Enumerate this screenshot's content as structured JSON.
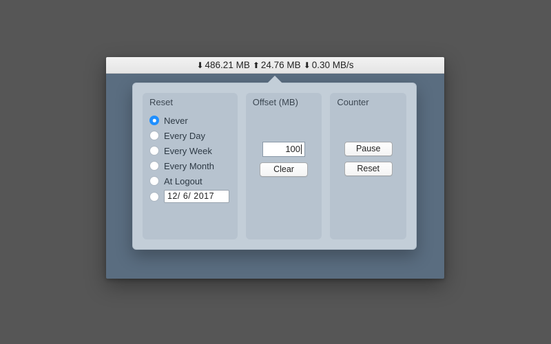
{
  "titlebar": {
    "download_total": "486.21 MB",
    "upload_total": "24.76 MB",
    "rate": "0.30 MB/s"
  },
  "popover": {
    "reset": {
      "title": "Reset",
      "options": [
        {
          "label": "Never",
          "selected": true
        },
        {
          "label": "Every Day",
          "selected": false
        },
        {
          "label": "Every Week",
          "selected": false
        },
        {
          "label": "Every Month",
          "selected": false
        },
        {
          "label": "At Logout",
          "selected": false
        }
      ],
      "date_field": "12/ 6/ 2017"
    },
    "offset": {
      "title": "Offset (MB)",
      "value": "100",
      "clear_label": "Clear"
    },
    "counter": {
      "title": "Counter",
      "pause_label": "Pause",
      "reset_label": "Reset"
    }
  }
}
